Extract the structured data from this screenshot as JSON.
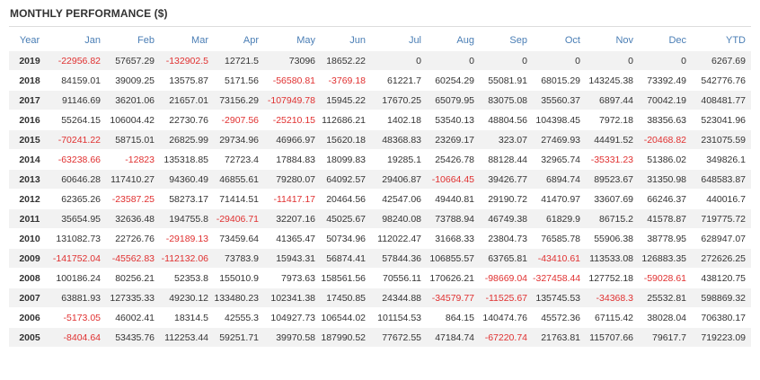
{
  "title": "MONTHLY PERFORMANCE ($)",
  "colors": {
    "header_text": "#4a7eb5",
    "negative": "#e03030",
    "stripe": "#f2f2f2"
  },
  "columns": [
    "Year",
    "Jan",
    "Feb",
    "Mar",
    "Apr",
    "May",
    "Jun",
    "Jul",
    "Aug",
    "Sep",
    "Oct",
    "Nov",
    "Dec",
    "YTD"
  ],
  "rows": [
    [
      "2019",
      "-22956.82",
      "57657.29",
      "-132902.5",
      "12721.5",
      "73096",
      "18652.22",
      "0",
      "0",
      "0",
      "0",
      "0",
      "0",
      "6267.69"
    ],
    [
      "2018",
      "84159.01",
      "39009.25",
      "13575.87",
      "5171.56",
      "-56580.81",
      "-3769.18",
      "61221.7",
      "60254.29",
      "55081.91",
      "68015.29",
      "143245.38",
      "73392.49",
      "542776.76"
    ],
    [
      "2017",
      "91146.69",
      "36201.06",
      "21657.01",
      "73156.29",
      "-107949.78",
      "15945.22",
      "17670.25",
      "65079.95",
      "83075.08",
      "35560.37",
      "6897.44",
      "70042.19",
      "408481.77"
    ],
    [
      "2016",
      "55264.15",
      "106004.42",
      "22730.76",
      "-2907.56",
      "-25210.15",
      "112686.21",
      "1402.18",
      "53540.13",
      "48804.56",
      "104398.45",
      "7972.18",
      "38356.63",
      "523041.96"
    ],
    [
      "2015",
      "-70241.22",
      "58715.01",
      "26825.99",
      "29734.96",
      "46966.97",
      "15620.18",
      "48368.83",
      "23269.17",
      "323.07",
      "27469.93",
      "44491.52",
      "-20468.82",
      "231075.59"
    ],
    [
      "2014",
      "-63238.66",
      "-12823",
      "135318.85",
      "72723.4",
      "17884.83",
      "18099.83",
      "19285.1",
      "25426.78",
      "88128.44",
      "32965.74",
      "-35331.23",
      "51386.02",
      "349826.1"
    ],
    [
      "2013",
      "60646.28",
      "117410.27",
      "94360.49",
      "46855.61",
      "79280.07",
      "64092.57",
      "29406.87",
      "-10664.45",
      "39426.77",
      "6894.74",
      "89523.67",
      "31350.98",
      "648583.87"
    ],
    [
      "2012",
      "62365.26",
      "-23587.25",
      "58273.17",
      "71414.51",
      "-11417.17",
      "20464.56",
      "42547.06",
      "49440.81",
      "29190.72",
      "41470.97",
      "33607.69",
      "66246.37",
      "440016.7"
    ],
    [
      "2011",
      "35654.95",
      "32636.48",
      "194755.8",
      "-29406.71",
      "32207.16",
      "45025.67",
      "98240.08",
      "73788.94",
      "46749.38",
      "61829.9",
      "86715.2",
      "41578.87",
      "719775.72"
    ],
    [
      "2010",
      "131082.73",
      "22726.76",
      "-29189.13",
      "73459.64",
      "41365.47",
      "50734.96",
      "112022.47",
      "31668.33",
      "23804.73",
      "76585.78",
      "55906.38",
      "38778.95",
      "628947.07"
    ],
    [
      "2009",
      "-141752.04",
      "-45562.83",
      "-112132.06",
      "73783.9",
      "15943.31",
      "56874.41",
      "57844.36",
      "106855.57",
      "63765.81",
      "-43410.61",
      "113533.08",
      "126883.35",
      "272626.25"
    ],
    [
      "2008",
      "100186.24",
      "80256.21",
      "52353.8",
      "155010.9",
      "7973.63",
      "158561.56",
      "70556.11",
      "170626.21",
      "-98669.04",
      "-327458.44",
      "127752.18",
      "-59028.61",
      "438120.75"
    ],
    [
      "2007",
      "63881.93",
      "127335.33",
      "49230.12",
      "133480.23",
      "102341.38",
      "17450.85",
      "24344.88",
      "-34579.77",
      "-11525.67",
      "135745.53",
      "-34368.3",
      "25532.81",
      "598869.32"
    ],
    [
      "2006",
      "-5173.05",
      "46002.41",
      "18314.5",
      "42555.3",
      "104927.73",
      "106544.02",
      "101154.53",
      "864.15",
      "140474.76",
      "45572.36",
      "67115.42",
      "38028.04",
      "706380.17"
    ],
    [
      "2005",
      "-8404.64",
      "53435.76",
      "112253.44",
      "59251.71",
      "39970.58",
      "187990.52",
      "77672.55",
      "47184.74",
      "-67220.74",
      "21763.81",
      "115707.66",
      "79617.7",
      "719223.09"
    ]
  ]
}
